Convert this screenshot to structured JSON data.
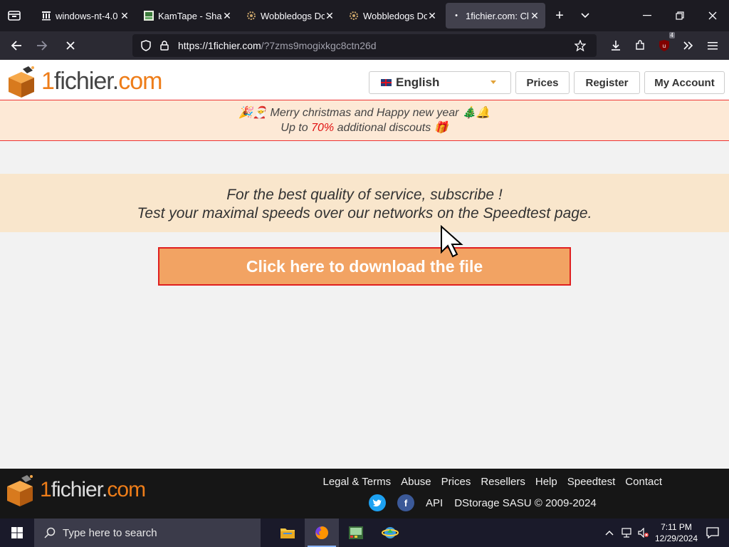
{
  "browser": {
    "tabs": [
      {
        "label": "windows-nt-4.0",
        "icon": "building-columns-icon",
        "active": false
      },
      {
        "label": "KamTape - Shar",
        "icon": "kamtape-icon",
        "active": false
      },
      {
        "label": "Wobbledogs Do",
        "icon": "wobbledogs-icon",
        "active": false
      },
      {
        "label": "Wobbledogs Do",
        "icon": "wobbledogs-icon",
        "active": false
      },
      {
        "label": "1fichier.com: Cl",
        "icon": "loading-dot-icon",
        "active": true
      }
    ],
    "url_host": "https://1fichier.com",
    "url_path": "/?7zms9mogixkgc8ctn26d",
    "extension_badge": "4"
  },
  "site": {
    "logo": {
      "part1": "1",
      "part2": "fichier.",
      "part3": "com"
    },
    "language": "English",
    "nav": {
      "prices": "Prices",
      "register": "Register",
      "account": "My Account"
    },
    "banner": {
      "line1": "Merry christmas and Happy new year",
      "line2_pre": "Up to ",
      "line2_highlight": "70%",
      "line2_post": " additional discouts"
    },
    "promo": {
      "line1": "For the best quality of service, subscribe !",
      "line2": "Test your maximal speeds over our networks on the Speedtest page."
    },
    "download_button": "Click here to download the file",
    "footer": {
      "links": [
        "Legal & Terms",
        "Abuse",
        "Prices",
        "Resellers",
        "Help",
        "Speedtest",
        "Contact"
      ],
      "api": "API",
      "copyright": "DStorage SASU © 2009-2024"
    }
  },
  "taskbar": {
    "search_placeholder": "Type here to search",
    "time": "7:11 PM",
    "date": "12/29/2024"
  },
  "colors": {
    "accent_orange": "#ee7d19",
    "button_fill": "#f2a363",
    "button_border": "#e02020",
    "highlight_red": "#e01010"
  }
}
